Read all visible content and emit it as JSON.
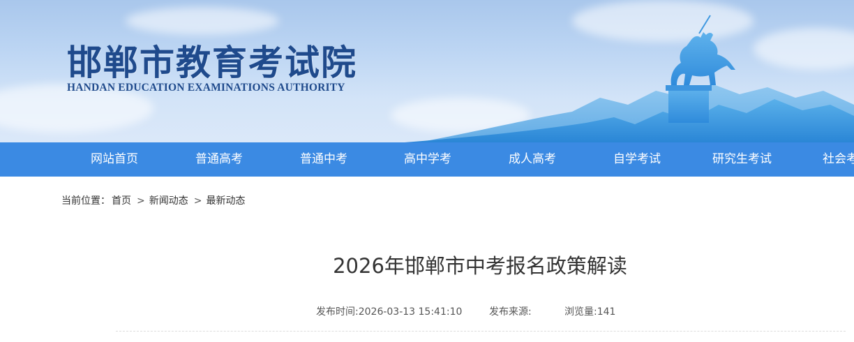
{
  "header": {
    "title_cn": "邯郸市教育考试院",
    "title_en": "HANDAN EDUCATION EXAMINATIONS AUTHORITY"
  },
  "nav": {
    "items": [
      {
        "label": "网站首页"
      },
      {
        "label": "普通高考"
      },
      {
        "label": "普通中考"
      },
      {
        "label": "高中学考"
      },
      {
        "label": "成人高考"
      },
      {
        "label": "自学考试"
      },
      {
        "label": "研究生考试"
      },
      {
        "label": "社会考"
      }
    ]
  },
  "breadcrumb": {
    "prefix": "当前位置：",
    "items": [
      "首页",
      "新闻动态",
      "最新动态"
    ],
    "separator": ">"
  },
  "article": {
    "title": "2026年邯郸市中考报名政策解读",
    "publish_time": "发布时间:2026-03-13 15:41:10",
    "source": "发布来源:",
    "views": "浏览量:141"
  },
  "colors": {
    "nav_bg": "#3b8ae3",
    "title_blue": "#1f4a8c"
  }
}
